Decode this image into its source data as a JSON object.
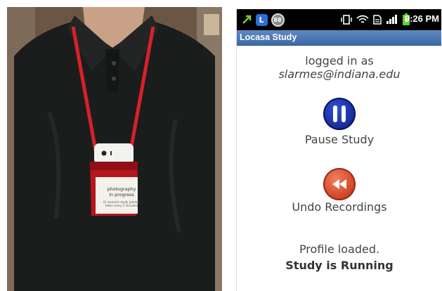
{
  "photo": {
    "card_line1": "photography",
    "card_line2": "in progress",
    "card_line3": "IU research study (photos taken every 5 minutes)"
  },
  "phone": {
    "status_bar": {
      "time": "9:26 PM",
      "icons": [
        "usb-debug-icon",
        "app-notification-icon",
        "battery-percent-badge-icon",
        "vibrate-icon",
        "wifi-icon",
        "sd-card-icon",
        "signal-icon",
        "charging-battery-icon"
      ],
      "badge_value": "88"
    },
    "title": "Locasa Study",
    "logged_in_label": "logged in as",
    "email": "slarmes@indiana.edu",
    "pause_label": "Pause Study",
    "undo_label": "Undo Recordings",
    "profile_status": "Profile loaded.",
    "study_status": "Study is Running"
  },
  "colors": {
    "title_bar": "#4a76b4",
    "pause_button": "#1a2fa0",
    "undo_button": "#d44a2a",
    "strap": "#d8202a"
  }
}
